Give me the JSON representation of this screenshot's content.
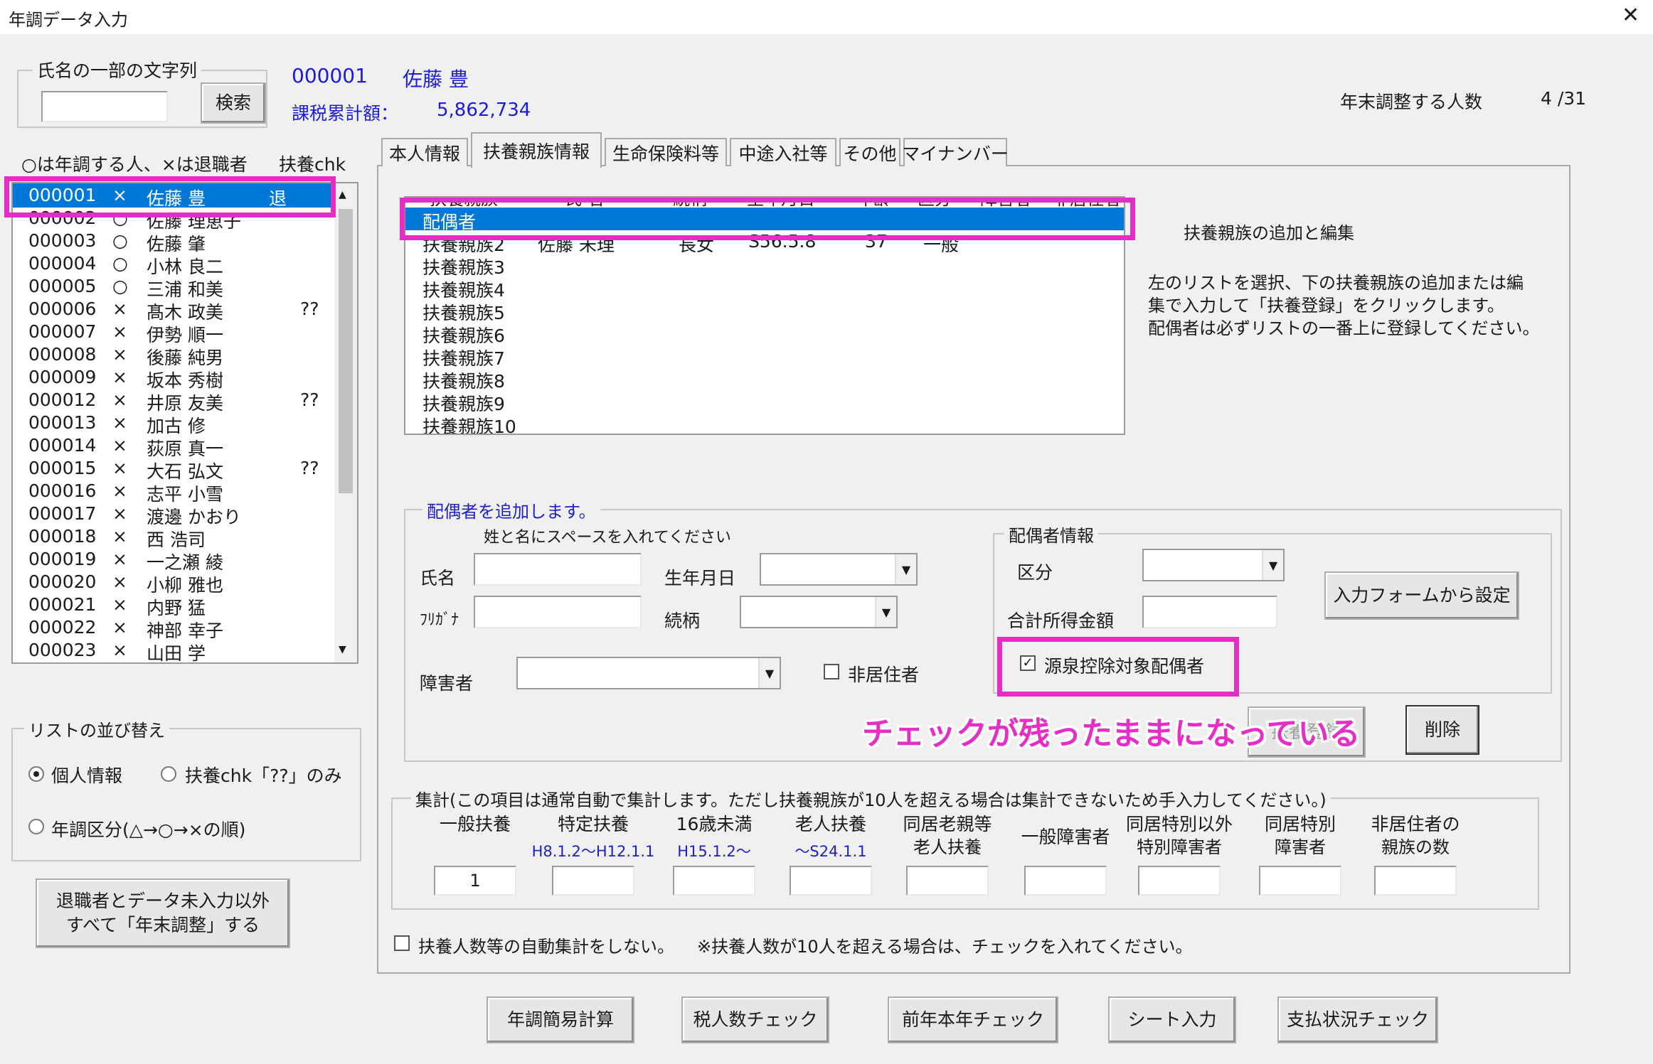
{
  "window": {
    "title": "年調データ入力",
    "close_glyph": "✕"
  },
  "search": {
    "group_label": "氏名の一部の文字列",
    "input_value": "",
    "button_label": "検索"
  },
  "current": {
    "id": "000001",
    "name": "佐藤 豊",
    "taxable_label": "課税累計額：",
    "taxable_value": "5,862,734"
  },
  "summary": {
    "label": "年末調整する人数",
    "value": "4 /31"
  },
  "employee_list": {
    "header": "○は年調する人、×は退職者",
    "header_chk": "扶養chk",
    "rows": [
      {
        "id": "000001",
        "mark": "×",
        "name": "佐藤 豊",
        "flag": "退"
      },
      {
        "id": "000002",
        "mark": "○",
        "name": "佐藤 理恵子",
        "flag": ""
      },
      {
        "id": "000003",
        "mark": "○",
        "name": "佐藤 肇",
        "flag": ""
      },
      {
        "id": "000004",
        "mark": "○",
        "name": "小林 良二",
        "flag": ""
      },
      {
        "id": "000005",
        "mark": "○",
        "name": "三浦 和美",
        "flag": ""
      },
      {
        "id": "000006",
        "mark": "×",
        "name": "髙木 政美",
        "flag": "??"
      },
      {
        "id": "000007",
        "mark": "×",
        "name": "伊勢 順一",
        "flag": ""
      },
      {
        "id": "000008",
        "mark": "×",
        "name": "後藤 純男",
        "flag": ""
      },
      {
        "id": "000009",
        "mark": "×",
        "name": "坂本 秀樹",
        "flag": ""
      },
      {
        "id": "000012",
        "mark": "×",
        "name": "井原 友美",
        "flag": "??"
      },
      {
        "id": "000013",
        "mark": "×",
        "name": "加古 修",
        "flag": ""
      },
      {
        "id": "000014",
        "mark": "×",
        "name": "荻原 真一",
        "flag": ""
      },
      {
        "id": "000015",
        "mark": "×",
        "name": "大石 弘文",
        "flag": "??"
      },
      {
        "id": "000016",
        "mark": "×",
        "name": "志平 小雪",
        "flag": ""
      },
      {
        "id": "000017",
        "mark": "×",
        "name": "渡邊 かおり",
        "flag": ""
      },
      {
        "id": "000018",
        "mark": "×",
        "name": "西 浩司",
        "flag": ""
      },
      {
        "id": "000019",
        "mark": "×",
        "name": "一之瀬 綾",
        "flag": ""
      },
      {
        "id": "000020",
        "mark": "×",
        "name": "小柳 雅也",
        "flag": ""
      },
      {
        "id": "000021",
        "mark": "×",
        "name": "内野 猛",
        "flag": ""
      },
      {
        "id": "000022",
        "mark": "×",
        "name": "神部 幸子",
        "flag": ""
      },
      {
        "id": "000023",
        "mark": "×",
        "name": "山田 学",
        "flag": ""
      }
    ]
  },
  "sort": {
    "group_label": "リストの並び替え",
    "opt1": "個人情報",
    "opt2": "扶養chk「??」のみ",
    "opt3": "年調区分(△→○→×の順)"
  },
  "bulk_button": {
    "line1": "退職者とデータ未入力以外",
    "line2": "すべて「年末調整」する"
  },
  "tabs": [
    "本人情報",
    "扶養親族情報",
    "生命保険料等",
    "中途入社等",
    "その他",
    "マイナンバー"
  ],
  "dependents": {
    "headers": [
      "扶養親族",
      "氏 名",
      "続柄",
      "生年月日",
      "年齢",
      "区分",
      "障害者",
      "非居住者"
    ],
    "rows": [
      {
        "label": "配偶者",
        "name": "",
        "rel": "",
        "birth": "",
        "age": "",
        "cat": ""
      },
      {
        "label": "扶養親族2",
        "name": "佐藤 未理",
        "rel": "長女",
        "birth": "S56.5.8",
        "age": "37",
        "cat": "一般"
      },
      {
        "label": "扶養親族3",
        "name": "",
        "rel": "",
        "birth": "",
        "age": "",
        "cat": ""
      },
      {
        "label": "扶養親族4",
        "name": "",
        "rel": "",
        "birth": "",
        "age": "",
        "cat": ""
      },
      {
        "label": "扶養親族5",
        "name": "",
        "rel": "",
        "birth": "",
        "age": "",
        "cat": ""
      },
      {
        "label": "扶養親族6",
        "name": "",
        "rel": "",
        "birth": "",
        "age": "",
        "cat": ""
      },
      {
        "label": "扶養親族7",
        "name": "",
        "rel": "",
        "birth": "",
        "age": "",
        "cat": ""
      },
      {
        "label": "扶養親族8",
        "name": "",
        "rel": "",
        "birth": "",
        "age": "",
        "cat": ""
      },
      {
        "label": "扶養親族9",
        "name": "",
        "rel": "",
        "birth": "",
        "age": "",
        "cat": ""
      },
      {
        "label": "扶養親族10",
        "name": "",
        "rel": "",
        "birth": "",
        "age": "",
        "cat": ""
      }
    ]
  },
  "help": {
    "title": "扶養親族の追加と編集",
    "line1": "左のリストを選択、下の扶養親族の追加または編",
    "line2": "集で入力して「扶養登録」をクリックします。",
    "line3": "配偶者は必ずリストの一番上に登録してください。"
  },
  "form": {
    "group_label": "配偶者を追加します。",
    "hint": "姓と名にスペースを入れてください",
    "name_label": "氏名",
    "kana_label": "ﾌﾘｶﾞﾅ",
    "birth_label": "生年月日",
    "rel_label": "続柄",
    "disability_label": "障害者",
    "nonresident_label": "非居住者",
    "spouse_group": "配偶者情報",
    "category_label": "区分",
    "income_label": "合計所得金額",
    "withholding_label": "源泉控除対象配偶者",
    "from_form_button": "入力フォームから設定",
    "register_button": "扶養登録",
    "delete_button": "削除"
  },
  "annotation": "チェックが残ったままになっている",
  "totals": {
    "group_label": "集計(この項目は通常自動で集計します。ただし扶養親族が10人を超える場合は集計できないため手入力してください。)",
    "cols": [
      {
        "l1": "一般扶養",
        "l2": "",
        "range": "",
        "value": "1"
      },
      {
        "l1": "特定扶養",
        "l2": "",
        "range": "H8.1.2～H12.1.1",
        "value": ""
      },
      {
        "l1": "16歳未満",
        "l2": "",
        "range": "H15.1.2～",
        "value": ""
      },
      {
        "l1": "老人扶養",
        "l2": "",
        "range": "～S24.1.1",
        "value": ""
      },
      {
        "l1": "同居老親等",
        "l2": "老人扶養",
        "range": "",
        "value": ""
      },
      {
        "l1": "一般障害者",
        "l2": "",
        "range": "",
        "value": ""
      },
      {
        "l1": "同居特別以外",
        "l2": "特別障害者",
        "range": "",
        "value": ""
      },
      {
        "l1": "同居特別",
        "l2": "障害者",
        "range": "",
        "value": ""
      },
      {
        "l1": "非居住者の",
        "l2": "親族の数",
        "range": "",
        "value": ""
      }
    ]
  },
  "auto": {
    "label": "扶養人数等の自動集計をしない。",
    "note": "※扶養人数が10人を超える場合は、チェックを入れてください。"
  },
  "bottom_buttons": [
    "年調簡易計算",
    "税人数チェック",
    "前年本年チェック",
    "シート入力",
    "支払状況チェック"
  ],
  "colors": {
    "highlight": "#e62dc5",
    "selection": "#0078d7",
    "link_blue": "#1b1bd9"
  }
}
